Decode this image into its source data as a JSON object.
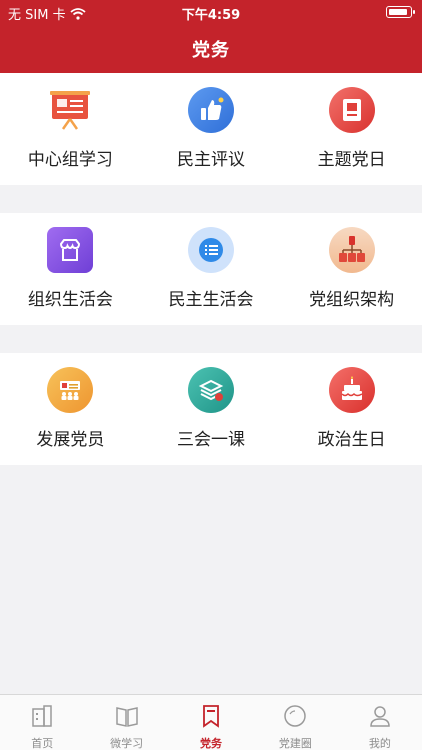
{
  "status_bar": {
    "carrier": "无 SIM 卡",
    "time": "下午4:59"
  },
  "header": {
    "title": "党务"
  },
  "sections": [
    {
      "items": [
        {
          "label": "中心组学习",
          "icon": "presentation-board-icon",
          "color": "#e8533f"
        },
        {
          "label": "民主评议",
          "icon": "thumbs-up-icon",
          "color": "#3a7be0"
        },
        {
          "label": "主题党日",
          "icon": "party-document-icon",
          "color": "#e84a4a"
        }
      ]
    },
    {
      "items": [
        {
          "label": "组织生活会",
          "icon": "shop-icon",
          "color": "#8b4fe0"
        },
        {
          "label": "民主生活会",
          "icon": "chat-list-icon",
          "color": "#2f8ae8"
        },
        {
          "label": "党组织架构",
          "icon": "org-structure-icon",
          "color": "#d86a3a"
        }
      ]
    },
    {
      "items": [
        {
          "label": "发展党员",
          "icon": "party-members-icon",
          "color": "#f0a030"
        },
        {
          "label": "三会一课",
          "icon": "book-stack-icon",
          "color": "#2aa89a"
        },
        {
          "label": "政治生日",
          "icon": "birthday-cake-icon",
          "color": "#e8443a"
        }
      ]
    }
  ],
  "tabbar": {
    "active": "党务",
    "tabs": [
      {
        "label": "首页",
        "icon": "building-icon"
      },
      {
        "label": "微学习",
        "icon": "open-book-icon"
      },
      {
        "label": "党务",
        "icon": "bookmark-icon"
      },
      {
        "label": "党建圈",
        "icon": "circle-icon"
      },
      {
        "label": "我的",
        "icon": "user-icon"
      }
    ]
  },
  "colors": {
    "brand": "#c4232b",
    "background": "#f2f2f4"
  }
}
